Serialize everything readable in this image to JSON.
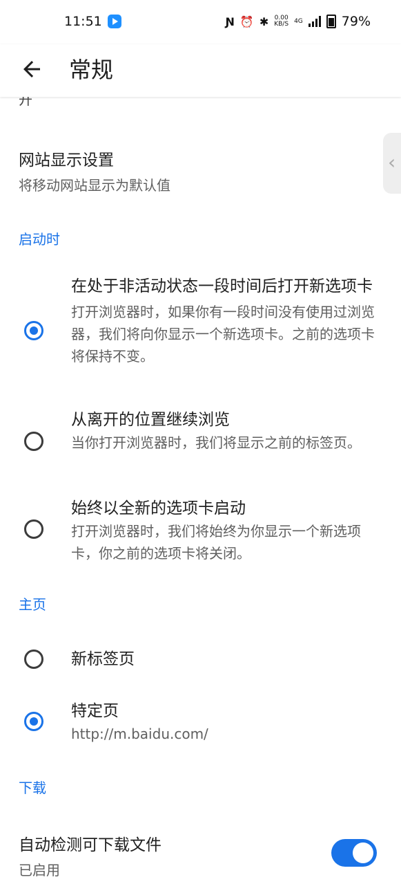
{
  "status_bar": {
    "time": "11:51",
    "network_speed": "0.00",
    "speed_unit": "KB/S",
    "network_type": "4G",
    "battery": "79%"
  },
  "app_bar": {
    "title": "常规"
  },
  "clipped_text": "开",
  "site_display": {
    "title": "网站显示设置",
    "subtitle": "将移动网站显示为默认值"
  },
  "startup": {
    "header": "启动时",
    "options": [
      {
        "title": "在处于非活动状态一段时间后打开新选项卡",
        "subtitle": "打开浏览器时，如果你有一段时间没有使用过浏览器，我们将向你显示一个新选项卡。之前的选项卡将保持不变。",
        "checked": true
      },
      {
        "title": "从离开的位置继续浏览",
        "subtitle": "当你打开浏览器时，我们将显示之前的标签页。",
        "checked": false
      },
      {
        "title": "始终以全新的选项卡启动",
        "subtitle": "打开浏览器时，我们将始终为你显示一个新选项卡，你之前的选项卡将关闭。",
        "checked": false
      }
    ]
  },
  "homepage": {
    "header": "主页",
    "options": [
      {
        "title": "新标签页",
        "checked": false
      },
      {
        "title": "特定页",
        "subtitle": "http://m.baidu.com/",
        "checked": true
      }
    ]
  },
  "downloads": {
    "header": "下载",
    "auto_detect": {
      "title": "自动检测可下载文件",
      "subtitle": "已启用",
      "enabled": true
    }
  },
  "colors": {
    "accent": "#1a73e8"
  }
}
